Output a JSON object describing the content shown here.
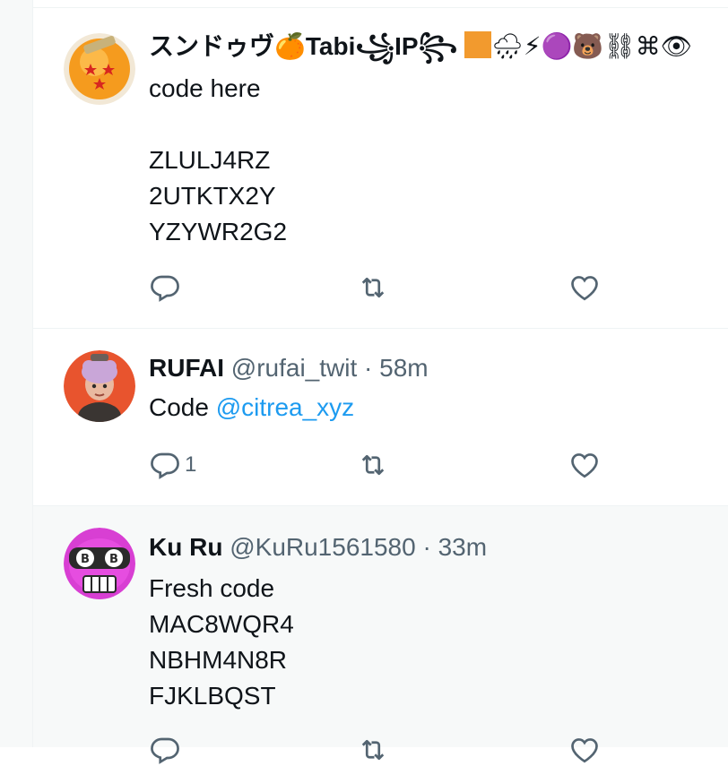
{
  "tweets": [
    {
      "display_name": "スンドゥヴ🍊Tabi꧁IP꧂",
      "name_suffix": "🌧⚡🟣🐻⛓⌘👁",
      "handle": "",
      "time": "",
      "body_lines": [
        "code here",
        "",
        "ZLULJ4RZ",
        "2UTKTX2Y",
        "YZYWR2G2"
      ],
      "reply_count": ""
    },
    {
      "display_name": "RUFAI",
      "handle": "@rufai_twit",
      "dot": "·",
      "time": "58m",
      "body_prefix": "Code ",
      "mention": "@citrea_xyz",
      "reply_count": "1"
    },
    {
      "display_name": "Ku Ru",
      "handle": "@KuRu1561580",
      "dot": "·",
      "time": "33m",
      "body_lines": [
        "Fresh code",
        "MAC8WQR4",
        "NBHM4N8R",
        "FJKLBQST"
      ],
      "reply_count": ""
    }
  ],
  "colors": {
    "text": "#0f1419",
    "secondary": "#536471",
    "link": "#1d9bf0",
    "divider": "#eff3f4",
    "hover_bg": "#f7f9f9"
  },
  "icons": [
    "reply-icon",
    "retweet-icon",
    "like-icon",
    "orange-square-emoji"
  ]
}
